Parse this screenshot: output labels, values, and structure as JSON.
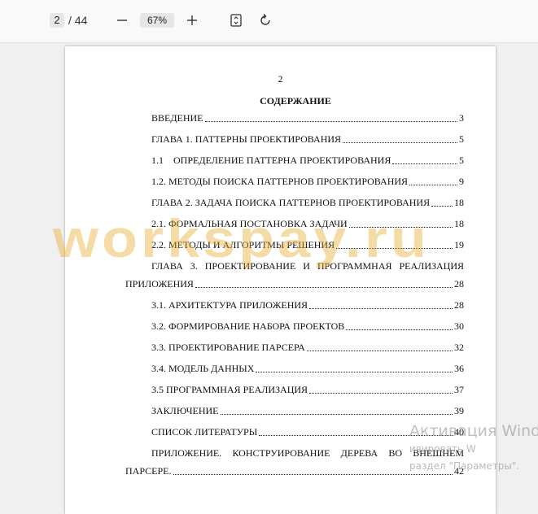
{
  "toolbar": {
    "current_page": "2",
    "total_pages": "/ 44",
    "zoom_level": "67%"
  },
  "document": {
    "page_number": "2",
    "toc_title": "СОДЕРЖАНИЕ",
    "entries": [
      {
        "title": "ВВЕДЕНИЕ",
        "page": "3"
      },
      {
        "title": "ГЛАВА 1. ПАТТЕРНЫ ПРОЕКТИРОВАНИЯ",
        "page": "5"
      },
      {
        "title": "1.1    ОПРЕДЕЛЕНИЕ ПАТТЕРНА ПРОЕКТИРОВАНИЯ",
        "page": "5"
      },
      {
        "title": "1.2. МЕТОДЫ ПОИСКА ПАТТЕРНОВ ПРОЕКТИРОВАНИЯ",
        "page": "9"
      },
      {
        "title": "ГЛАВА 2. ЗАДАЧА ПОИСКА ПАТТЕРНОВ ПРОЕКТИРОВАНИЯ",
        "page": "18"
      },
      {
        "title": "2.1. ФОРМАЛЬНАЯ ПОСТАНОВКА ЗАДАЧИ",
        "page": "18"
      },
      {
        "title": "2.2. МЕТОДЫ И АЛГОРИТМЫ РЕШЕНИЯ",
        "page": "19"
      },
      {
        "title": "ГЛАВА 3. ПРОЕКТИРОВАНИЕ И ПРОГРАММНАЯ РЕАЛИЗАЦИЯ",
        "title_cont": "ПРИЛОЖЕНИЯ",
        "page": "28"
      },
      {
        "title": "3.1. АРХИТЕКТУРА ПРИЛОЖЕНИЯ",
        "page": "28"
      },
      {
        "title": "3.2. ФОРМИРОВАНИЕ НАБОРА ПРОЕКТОВ",
        "page": "30"
      },
      {
        "title": "3.3. ПРОЕКТИРОВАНИЕ ПАРСЕРА",
        "page": "32"
      },
      {
        "title": "3.4. МОДЕЛЬ ДАННЫХ",
        "page": "36"
      },
      {
        "title": "3.5 ПРОГРАММНАЯ РЕАЛИЗАЦИЯ",
        "page": "37"
      },
      {
        "title": "ЗАКЛЮЧЕНИЕ",
        "page": "39"
      },
      {
        "title": "СПИСОК ЛИТЕРАТУРЫ",
        "page": "40"
      },
      {
        "title": "ПРИЛОЖЕНИЕ. КОНСТРУИРОВАНИЕ ДЕРЕВА ВО ВНЕШНЕМ",
        "title_cont": "ПАРСЕРЕ.",
        "page": "42"
      }
    ],
    "watermark": "workspay.ru"
  },
  "overlay": {
    "activation_title": "Активация Windo",
    "activation_line2": "ивировать W",
    "activation_line3": "раздел \"Параметры\"."
  },
  "icons": {
    "zoom_out": "minus-icon",
    "zoom_in": "plus-icon",
    "fit": "fit-page-icon",
    "rotate": "rotate-icon"
  }
}
